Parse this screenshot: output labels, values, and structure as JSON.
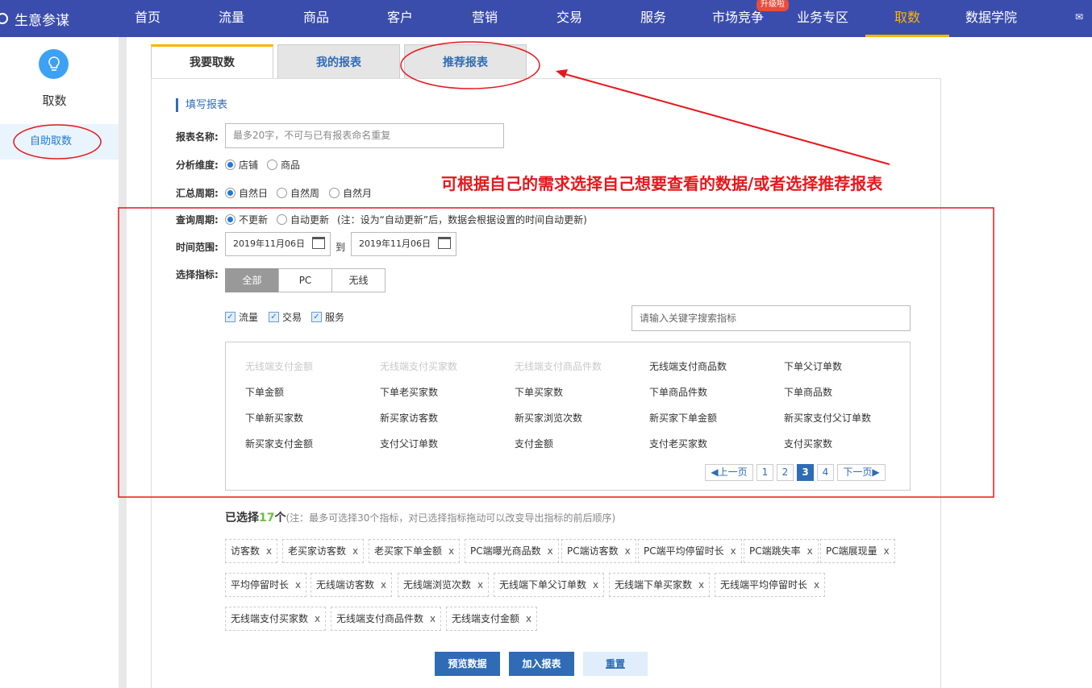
{
  "app": {
    "name": "生意参谋",
    "upgrade_badge": "升级啦"
  },
  "nav": [
    "首页",
    "流量",
    "商品",
    "客户",
    "营销",
    "交易",
    "服务",
    "市场竞争",
    "业务专区",
    "取数",
    "数据学院"
  ],
  "sidebar": {
    "title": "取数",
    "item": "自助取数"
  },
  "tabs": [
    "我要取数",
    "我的报表",
    "推荐报表"
  ],
  "form": {
    "section_title": "填写报表",
    "name_label": "报表名称:",
    "name_placeholder": "最多20字，不可与已有报表命名重复",
    "dimension_label": "分析维度:",
    "dimension_options": [
      "店铺",
      "商品"
    ],
    "summary_label": "汇总周期:",
    "summary_options": [
      "自然日",
      "自然周",
      "自然月"
    ],
    "query_label": "查询周期:",
    "query_options": [
      "不更新",
      "自动更新"
    ],
    "query_note": "(注：设为“自动更新”后，数据会根据设置的时间自动更新)",
    "time_label": "时间范围:",
    "date_from": "2019年11月06日",
    "date_to_label": "到",
    "date_to": "2019年11月06日",
    "metric_label": "选择指标:",
    "segments": [
      "全部",
      "PC",
      "无线"
    ],
    "checkboxes": [
      "流量",
      "交易",
      "服务"
    ],
    "search_placeholder": "请输入关键字搜索指标"
  },
  "metrics": [
    [
      "无线端支付金额",
      "无线端支付买家数",
      "无线端支付商品件数",
      "无线端支付商品数",
      "下单父订单数"
    ],
    [
      "下单金额",
      "下单老买家数",
      "下单买家数",
      "下单商品件数",
      "下单商品数"
    ],
    [
      "下单新买家数",
      "新买家访客数",
      "新买家浏览次数",
      "新买家下单金额",
      "新买家支付父订单数"
    ],
    [
      "新买家支付金额",
      "支付父订单数",
      "支付金额",
      "支付老买家数",
      "支付买家数"
    ]
  ],
  "pager": {
    "prev": "上一页",
    "pages": [
      "1",
      "2",
      "3",
      "4"
    ],
    "current": "3",
    "next": "下一页"
  },
  "selected": {
    "prefix": "已选择",
    "count": "17",
    "suffix": "个",
    "note": "(注：最多可选择30个指标，对已选择指标拖动可以改变导出指标的前后顺序)",
    "chips": [
      "访客数",
      "老买家访客数",
      "老买家下单金额",
      "PC端曝光商品数",
      "PC端访客数",
      "PC端平均停留时长",
      "PC端跳失率",
      "PC端展现量",
      "平均停留时长",
      "无线端访客数",
      "无线端浏览次数",
      "无线端下单父订单数",
      "无线端下单买家数",
      "无线端平均停留时长",
      "无线端支付买家数",
      "无线端支付商品件数",
      "无线端支付金额"
    ]
  },
  "buttons": {
    "preview": "预览数据",
    "add": "加入报表",
    "reset": "重置"
  },
  "annotation": "可根据自己的需求选择自己想要查看的数据/或者选择推荐报表",
  "colors": {
    "nav_bg": "#3a4dad",
    "accent": "#ffb400",
    "link": "#2f6cb5",
    "annotation": "#e8161c"
  }
}
